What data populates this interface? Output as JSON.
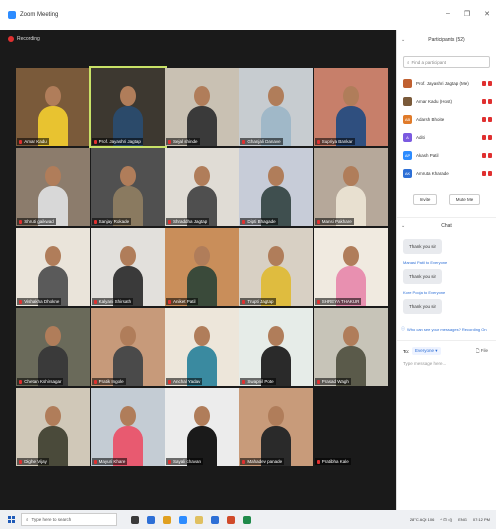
{
  "window": {
    "title": "Zoom Meeting"
  },
  "recording": {
    "label": "Recording"
  },
  "colors": {
    "accent": "#2d8cff",
    "active_speaker": "#c9e267",
    "muted": "#e03030"
  },
  "tiles": [
    {
      "name": "Amar Kadu",
      "bg": "#7a5a3a",
      "shirt": "#e8c330"
    },
    {
      "name": "Prof. Jayashri Jagtap",
      "bg": "#3d3830",
      "shirt": "#2b4a6a",
      "active": true
    },
    {
      "name": "Sejal shinde",
      "bg": "#c9c1b3",
      "shirt": "#3a3a3a"
    },
    {
      "name": "Ghanjali Danave",
      "bg": "#c7ccd0",
      "shirt": "#a0b8c8"
    },
    {
      "name": "Supriya Bankar",
      "bg": "#c77f6a",
      "shirt": "#2f4f7f"
    },
    {
      "name": "Shruti gaikwad",
      "bg": "#8c7c6c",
      "shirt": "#d8d8d8"
    },
    {
      "name": "Sanjay Rokade",
      "bg": "#505050",
      "shirt": "#8a7a60"
    },
    {
      "name": "Shraddha Jagtap",
      "bg": "#e0dcd5",
      "shirt": "#4f4f4f"
    },
    {
      "name": "Dipti Bhagade",
      "bg": "#c7ccd8",
      "shirt": "#3f4f4f"
    },
    {
      "name": "Mansi Pakhare",
      "bg": "#b6a89a",
      "shirt": "#e8e0d0"
    },
    {
      "name": "Vishakha Dhokne",
      "bg": "#eae4da",
      "shirt": "#5a5a5a"
    },
    {
      "name": "Kalyani Shirsath",
      "bg": "#e2e0dc",
      "shirt": "#3a3a3a"
    },
    {
      "name": "Aniket Patil",
      "bg": "#c98e5a",
      "shirt": "#3a4a3a"
    },
    {
      "name": "Trupti Jagtap",
      "bg": "#d8d0c4",
      "shirt": "#dfbc3f"
    },
    {
      "name": "SHREYA THAKUR",
      "bg": "#f0eae0",
      "shirt": "#e890b0"
    },
    {
      "name": "Chetan Kshirsagar",
      "bg": "#6a6a5a",
      "shirt": "#3a3a3a"
    },
    {
      "name": "Pratik Ingole",
      "bg": "#c79a7a",
      "shirt": "#4a4a4a"
    },
    {
      "name": "Anchal Yadav",
      "bg": "#ede6da",
      "shirt": "#3a8aa0"
    },
    {
      "name": "Swapnil Pote",
      "bg": "#e6ece8",
      "shirt": "#2a2a2a"
    },
    {
      "name": "Prasad Wagh",
      "bg": "#c7c4b8",
      "shirt": "#5a5a4a"
    },
    {
      "name": "Dighe Vijay",
      "bg": "#d0c8b8",
      "shirt": "#4a4a3a"
    },
    {
      "name": "Mayuri Khare",
      "bg": "#c4ccd4",
      "shirt": "#e85a70"
    },
    {
      "name": "Sayali chavan",
      "bg": "#ececec",
      "shirt": "#1a1a1a"
    },
    {
      "name": "Mahadev panade",
      "bg": "#c89b7a",
      "shirt": "#2a2a2a"
    },
    {
      "name": "Pratibha Kale",
      "bg": "#1a1a1a",
      "shirt": "#1a1a1a",
      "off": true
    }
  ],
  "participants": {
    "title": "Participants (52)",
    "find_placeholder": "Find a participant",
    "list": [
      {
        "name": "Prof. Jayashri Jagtap (Me)",
        "initials": "",
        "color": "#c06030"
      },
      {
        "name": "Amar Kadu (Host)",
        "initials": "",
        "color": "#7a5a3a"
      },
      {
        "name": "Adarsh Bhoite",
        "initials": "AB",
        "color": "#e07b2a"
      },
      {
        "name": "Aditi",
        "initials": "A",
        "color": "#7b5ae0"
      },
      {
        "name": "Akash Patil",
        "initials": "AP",
        "color": "#2d8cff"
      },
      {
        "name": "Amruta Kharade",
        "initials": "AK",
        "color": "#2d6fd6"
      }
    ],
    "invite_label": "Invite",
    "mute_all_label": "Mute Me"
  },
  "chat": {
    "title": "Chat",
    "messages": [
      {
        "from": "",
        "text": "Thank you sir"
      },
      {
        "from": "Manasi Patil to Everyone",
        "text": "Thank you sir"
      },
      {
        "from": "Kore Pooja to Everyone",
        "text": "Thank you sir"
      }
    ],
    "hint": "Who can see your messages? Recording On",
    "to_label": "To:",
    "to_value": "Everyone",
    "file_label": "File",
    "input_placeholder": "Type message here..."
  },
  "taskbar": {
    "search_placeholder": "Type here to search",
    "weather": "28°C AQI 106",
    "lang": "ENG",
    "time": "07:12 PM",
    "date": "IN"
  }
}
